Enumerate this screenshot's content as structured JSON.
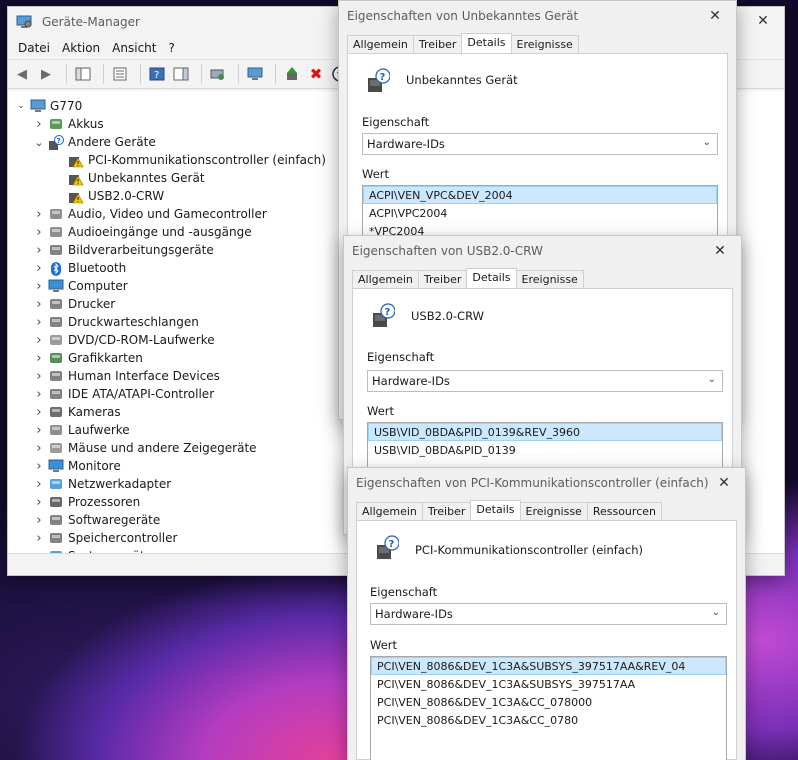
{
  "device_manager": {
    "title": "Geräte-Manager",
    "menu": [
      "Datei",
      "Aktion",
      "Ansicht",
      "?"
    ],
    "root": "G770",
    "tree": [
      {
        "label": "Akkus",
        "level": 1,
        "expanded": false,
        "icon": "battery-icon",
        "color": "#3a8a3a"
      },
      {
        "label": "Andere Geräte",
        "level": 1,
        "expanded": true,
        "icon": "unknown-device-icon",
        "color": "#6d6d6d"
      },
      {
        "label": "PCI-Kommunikationscontroller (einfach)",
        "level": 2,
        "icon": "warning-device-icon",
        "color": "#e0a400"
      },
      {
        "label": "Unbekanntes Gerät",
        "level": 2,
        "icon": "warning-device-icon",
        "color": "#e0a400"
      },
      {
        "label": "USB2.0-CRW",
        "level": 2,
        "icon": "warning-device-icon",
        "color": "#e0a400"
      },
      {
        "label": "Audio, Video und Gamecontroller",
        "level": 1,
        "expanded": false,
        "icon": "speaker-icon",
        "color": "#7a7a7a"
      },
      {
        "label": "Audioeingänge und -ausgänge",
        "level": 1,
        "expanded": false,
        "icon": "speaker-icon",
        "color": "#7a7a7a"
      },
      {
        "label": "Bildverarbeitungsgeräte",
        "level": 1,
        "expanded": false,
        "icon": "camera-device-icon",
        "color": "#6b6b6b"
      },
      {
        "label": "Bluetooth",
        "level": 1,
        "expanded": false,
        "icon": "bluetooth-icon",
        "color": "#1f6fd1"
      },
      {
        "label": "Computer",
        "level": 1,
        "expanded": false,
        "icon": "computer-icon",
        "color": "#3b8fd6"
      },
      {
        "label": "Drucker",
        "level": 1,
        "expanded": false,
        "icon": "printer-icon",
        "color": "#6b6b6b"
      },
      {
        "label": "Druckwarteschlangen",
        "level": 1,
        "expanded": false,
        "icon": "printer-icon",
        "color": "#6b6b6b"
      },
      {
        "label": "DVD/CD-ROM-Laufwerke",
        "level": 1,
        "expanded": false,
        "icon": "disc-drive-icon",
        "color": "#8a8a8a"
      },
      {
        "label": "Grafikkarten",
        "level": 1,
        "expanded": false,
        "icon": "display-adapter-icon",
        "color": "#3a7a3a"
      },
      {
        "label": "Human Interface Devices",
        "level": 1,
        "expanded": false,
        "icon": "hid-icon",
        "color": "#6b6b6b"
      },
      {
        "label": "IDE ATA/ATAPI-Controller",
        "level": 1,
        "expanded": false,
        "icon": "ide-controller-icon",
        "color": "#6b6b6b"
      },
      {
        "label": "Kameras",
        "level": 1,
        "expanded": false,
        "icon": "webcam-icon",
        "color": "#555555"
      },
      {
        "label": "Laufwerke",
        "level": 1,
        "expanded": false,
        "icon": "disk-drive-icon",
        "color": "#7a7a7a"
      },
      {
        "label": "Mäuse und andere Zeigegeräte",
        "level": 1,
        "expanded": false,
        "icon": "mouse-icon",
        "color": "#8a8a8a"
      },
      {
        "label": "Monitore",
        "level": 1,
        "expanded": false,
        "icon": "monitor-icon",
        "color": "#3b8fd6"
      },
      {
        "label": "Netzwerkadapter",
        "level": 1,
        "expanded": false,
        "icon": "network-adapter-icon",
        "color": "#3b8fd6"
      },
      {
        "label": "Prozessoren",
        "level": 1,
        "expanded": false,
        "icon": "processor-icon",
        "color": "#4d4d4d"
      },
      {
        "label": "Softwaregeräte",
        "level": 1,
        "expanded": false,
        "icon": "software-device-icon",
        "color": "#6b6b6b"
      },
      {
        "label": "Speichercontroller",
        "level": 1,
        "expanded": false,
        "icon": "storage-controller-icon",
        "color": "#6b6b6b"
      },
      {
        "label": "Systemgeräte",
        "level": 1,
        "expanded": false,
        "icon": "system-device-icon",
        "color": "#3b8fd6"
      }
    ]
  },
  "dialogs": [
    {
      "id": "unknown",
      "title": "Eigenschaften von Unbekanntes Gerät",
      "tabs": [
        "Allgemein",
        "Treiber",
        "Details",
        "Ereignisse"
      ],
      "active_tab": "Details",
      "device_name": "Unbekanntes Gerät",
      "property_label": "Eigenschaft",
      "property_value": "Hardware-IDs",
      "value_label": "Wert",
      "values": [
        "ACPI\\VEN_VPC&DEV_2004",
        "ACPI\\VPC2004",
        "*VPC2004"
      ]
    },
    {
      "id": "usb",
      "title": "Eigenschaften von USB2.0-CRW",
      "tabs": [
        "Allgemein",
        "Treiber",
        "Details",
        "Ereignisse"
      ],
      "active_tab": "Details",
      "device_name": "USB2.0-CRW",
      "property_label": "Eigenschaft",
      "property_value": "Hardware-IDs",
      "value_label": "Wert",
      "values": [
        "USB\\VID_0BDA&PID_0139&REV_3960",
        "USB\\VID_0BDA&PID_0139"
      ]
    },
    {
      "id": "pci",
      "title": "Eigenschaften von PCI-Kommunikationscontroller (einfach)",
      "tabs": [
        "Allgemein",
        "Treiber",
        "Details",
        "Ereignisse",
        "Ressourcen"
      ],
      "active_tab": "Details",
      "device_name": "PCI-Kommunikationscontroller (einfach)",
      "property_label": "Eigenschaft",
      "property_value": "Hardware-IDs",
      "value_label": "Wert",
      "values": [
        "PCI\\VEN_8086&DEV_1C3A&SUBSYS_397517AA&REV_04",
        "PCI\\VEN_8086&DEV_1C3A&SUBSYS_397517AA",
        "PCI\\VEN_8086&DEV_1C3A&CC_078000",
        "PCI\\VEN_8086&DEV_1C3A&CC_0780"
      ]
    }
  ]
}
